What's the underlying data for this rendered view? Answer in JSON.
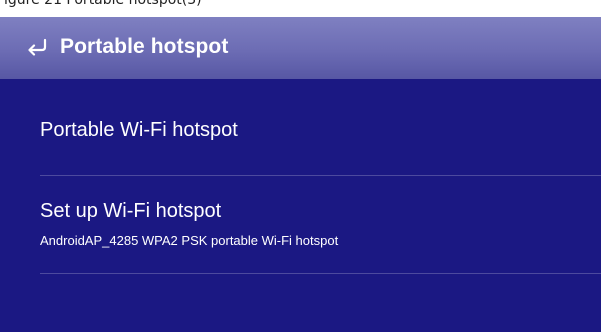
{
  "clipped_caption": "igure 21 Portable hotspot(3)",
  "action_bar": {
    "title": "Portable hotspot",
    "back_icon": "back-arrow-icon"
  },
  "preferences": [
    {
      "title": "Portable Wi-Fi hotspot",
      "summary": ""
    },
    {
      "title": "Set up Wi-Fi hotspot",
      "summary": "AndroidAP_4285 WPA2 PSK portable Wi-Fi hotspot"
    }
  ],
  "colors": {
    "background": "#1b1883",
    "action_bar": "#6c6cb4",
    "text": "#ffffff"
  }
}
